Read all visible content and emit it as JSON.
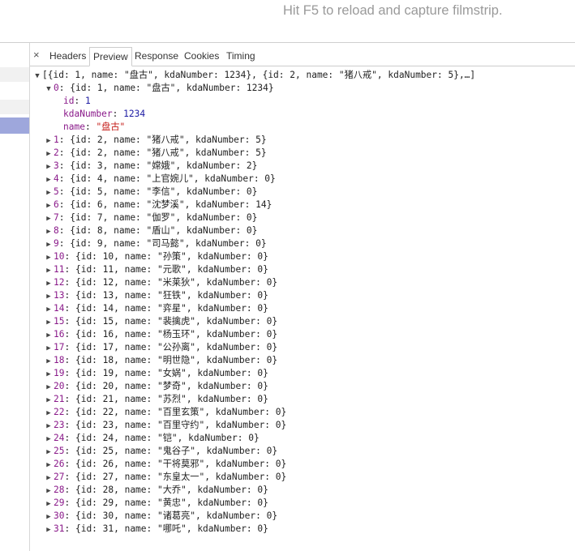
{
  "hint": "Hit F5 to reload and capture filmstrip.",
  "tabs": [
    {
      "label": "Headers",
      "active": false
    },
    {
      "label": "Preview",
      "active": true
    },
    {
      "label": "Response",
      "active": false
    },
    {
      "label": "Cookies",
      "active": false
    },
    {
      "label": "Timing",
      "active": false
    }
  ],
  "close_glyph": "×",
  "root_summary": "[{id: 1, name: \"盘古\", kdaNumber: 1234}, {id: 2, name: \"猪八戒\", kdaNumber: 5},…]",
  "expanded": {
    "key": "0",
    "summary": "{id: 1, name: \"盘古\", kdaNumber: 1234}",
    "fields": [
      {
        "key": "id",
        "value": "1",
        "type": "num"
      },
      {
        "key": "kdaNumber",
        "value": "1234",
        "type": "num"
      },
      {
        "key": "name",
        "value": "\"盘古\"",
        "type": "str"
      }
    ]
  },
  "items": [
    {
      "key": "1",
      "summary": "{id: 2, name: \"猪八戒\", kdaNumber: 5}"
    },
    {
      "key": "2",
      "summary": "{id: 2, name: \"猪八戒\", kdaNumber: 5}"
    },
    {
      "key": "3",
      "summary": "{id: 3, name: \"嫦娥\", kdaNumber: 2}"
    },
    {
      "key": "4",
      "summary": "{id: 4, name: \"上官婉儿\", kdaNumber: 0}"
    },
    {
      "key": "5",
      "summary": "{id: 5, name: \"李信\", kdaNumber: 0}"
    },
    {
      "key": "6",
      "summary": "{id: 6, name: \"沈梦溪\", kdaNumber: 14}"
    },
    {
      "key": "7",
      "summary": "{id: 7, name: \"伽罗\", kdaNumber: 0}"
    },
    {
      "key": "8",
      "summary": "{id: 8, name: \"盾山\", kdaNumber: 0}"
    },
    {
      "key": "9",
      "summary": "{id: 9, name: \"司马懿\", kdaNumber: 0}"
    },
    {
      "key": "10",
      "summary": "{id: 10, name: \"孙策\", kdaNumber: 0}"
    },
    {
      "key": "11",
      "summary": "{id: 11, name: \"元歌\", kdaNumber: 0}"
    },
    {
      "key": "12",
      "summary": "{id: 12, name: \"米莱狄\", kdaNumber: 0}"
    },
    {
      "key": "13",
      "summary": "{id: 13, name: \"狂铁\", kdaNumber: 0}"
    },
    {
      "key": "14",
      "summary": "{id: 14, name: \"弈星\", kdaNumber: 0}"
    },
    {
      "key": "15",
      "summary": "{id: 15, name: \"裴擒虎\", kdaNumber: 0}"
    },
    {
      "key": "16",
      "summary": "{id: 16, name: \"杨玉环\", kdaNumber: 0}"
    },
    {
      "key": "17",
      "summary": "{id: 17, name: \"公孙离\", kdaNumber: 0}"
    },
    {
      "key": "18",
      "summary": "{id: 18, name: \"明世隐\", kdaNumber: 0}"
    },
    {
      "key": "19",
      "summary": "{id: 19, name: \"女娲\", kdaNumber: 0}"
    },
    {
      "key": "20",
      "summary": "{id: 20, name: \"梦奇\", kdaNumber: 0}"
    },
    {
      "key": "21",
      "summary": "{id: 21, name: \"苏烈\", kdaNumber: 0}"
    },
    {
      "key": "22",
      "summary": "{id: 22, name: \"百里玄策\", kdaNumber: 0}"
    },
    {
      "key": "23",
      "summary": "{id: 23, name: \"百里守约\", kdaNumber: 0}"
    },
    {
      "key": "24",
      "summary": "{id: 24, name: \"铠\", kdaNumber: 0}"
    },
    {
      "key": "25",
      "summary": "{id: 25, name: \"鬼谷子\", kdaNumber: 0}"
    },
    {
      "key": "26",
      "summary": "{id: 26, name: \"干将莫邪\", kdaNumber: 0}"
    },
    {
      "key": "27",
      "summary": "{id: 27, name: \"东皇太一\", kdaNumber: 0}"
    },
    {
      "key": "28",
      "summary": "{id: 28, name: \"大乔\", kdaNumber: 0}"
    },
    {
      "key": "29",
      "summary": "{id: 29, name: \"黄忠\", kdaNumber: 0}"
    },
    {
      "key": "30",
      "summary": "{id: 30, name: \"诸葛亮\", kdaNumber: 0}"
    },
    {
      "key": "31",
      "summary": "{id: 31, name: \"哪吒\", kdaNumber: 0}"
    }
  ],
  "colors": {
    "key": "#8a1a8a",
    "number": "#1c1aa3",
    "string": "#c41a16",
    "selected_row": "#9ea7dc"
  }
}
